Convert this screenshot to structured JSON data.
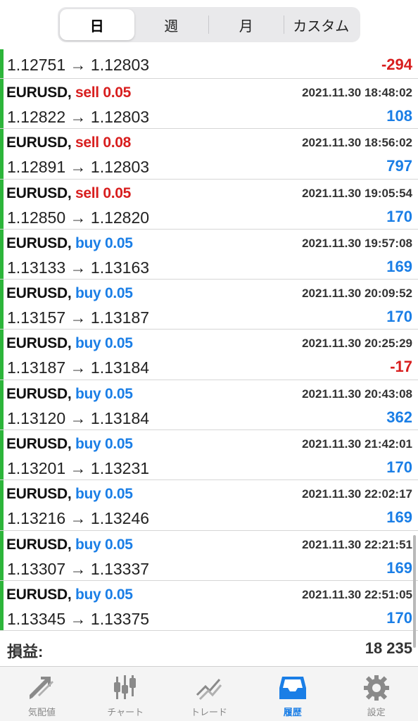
{
  "period_tabs": [
    {
      "label": "日",
      "active": true
    },
    {
      "label": "週",
      "active": false
    },
    {
      "label": "月",
      "active": false
    },
    {
      "label": "カスタム",
      "active": false
    }
  ],
  "trades": [
    {
      "symbol": "",
      "side": "",
      "side_type": "",
      "time": "",
      "from": "1.12751",
      "to": "1.12803",
      "profit": "-294"
    },
    {
      "symbol": "EURUSD,",
      "side": "sell 0.05",
      "side_type": "sell",
      "time": "2021.11.30 18:48:02",
      "from": "1.12822",
      "to": "1.12803",
      "profit": "108"
    },
    {
      "symbol": "EURUSD,",
      "side": "sell 0.08",
      "side_type": "sell",
      "time": "2021.11.30 18:56:02",
      "from": "1.12891",
      "to": "1.12803",
      "profit": "797"
    },
    {
      "symbol": "EURUSD,",
      "side": "sell 0.05",
      "side_type": "sell",
      "time": "2021.11.30 19:05:54",
      "from": "1.12850",
      "to": "1.12820",
      "profit": "170"
    },
    {
      "symbol": "EURUSD,",
      "side": "buy 0.05",
      "side_type": "buy",
      "time": "2021.11.30 19:57:08",
      "from": "1.13133",
      "to": "1.13163",
      "profit": "169"
    },
    {
      "symbol": "EURUSD,",
      "side": "buy 0.05",
      "side_type": "buy",
      "time": "2021.11.30 20:09:52",
      "from": "1.13157",
      "to": "1.13187",
      "profit": "170"
    },
    {
      "symbol": "EURUSD,",
      "side": "buy 0.05",
      "side_type": "buy",
      "time": "2021.11.30 20:25:29",
      "from": "1.13187",
      "to": "1.13184",
      "profit": "-17"
    },
    {
      "symbol": "EURUSD,",
      "side": "buy 0.05",
      "side_type": "buy",
      "time": "2021.11.30 20:43:08",
      "from": "1.13120",
      "to": "1.13184",
      "profit": "362"
    },
    {
      "symbol": "EURUSD,",
      "side": "buy 0.05",
      "side_type": "buy",
      "time": "2021.11.30 21:42:01",
      "from": "1.13201",
      "to": "1.13231",
      "profit": "170"
    },
    {
      "symbol": "EURUSD,",
      "side": "buy 0.05",
      "side_type": "buy",
      "time": "2021.11.30 22:02:17",
      "from": "1.13216",
      "to": "1.13246",
      "profit": "169"
    },
    {
      "symbol": "EURUSD,",
      "side": "buy 0.05",
      "side_type": "buy",
      "time": "2021.11.30 22:21:51",
      "from": "1.13307",
      "to": "1.13337",
      "profit": "169"
    },
    {
      "symbol": "EURUSD,",
      "side": "buy 0.05",
      "side_type": "buy",
      "time": "2021.11.30 22:51:05",
      "from": "1.13345",
      "to": "1.13375",
      "profit": "170"
    }
  ],
  "arrow": "→",
  "summary": {
    "label": "損益:",
    "value": "18 235"
  },
  "tabbar": [
    {
      "label": "気配値",
      "icon": "quotes-icon",
      "active": false
    },
    {
      "label": "チャート",
      "icon": "chart-icon",
      "active": false
    },
    {
      "label": "トレード",
      "icon": "trade-icon",
      "active": false
    },
    {
      "label": "履歴",
      "icon": "history-icon",
      "active": true
    },
    {
      "label": "設定",
      "icon": "settings-icon",
      "active": false
    }
  ],
  "colors": {
    "buy": "#1a7ee6",
    "sell": "#d81e1e",
    "accent": "#1a7ee6",
    "profit_bar": "#2db53a"
  }
}
